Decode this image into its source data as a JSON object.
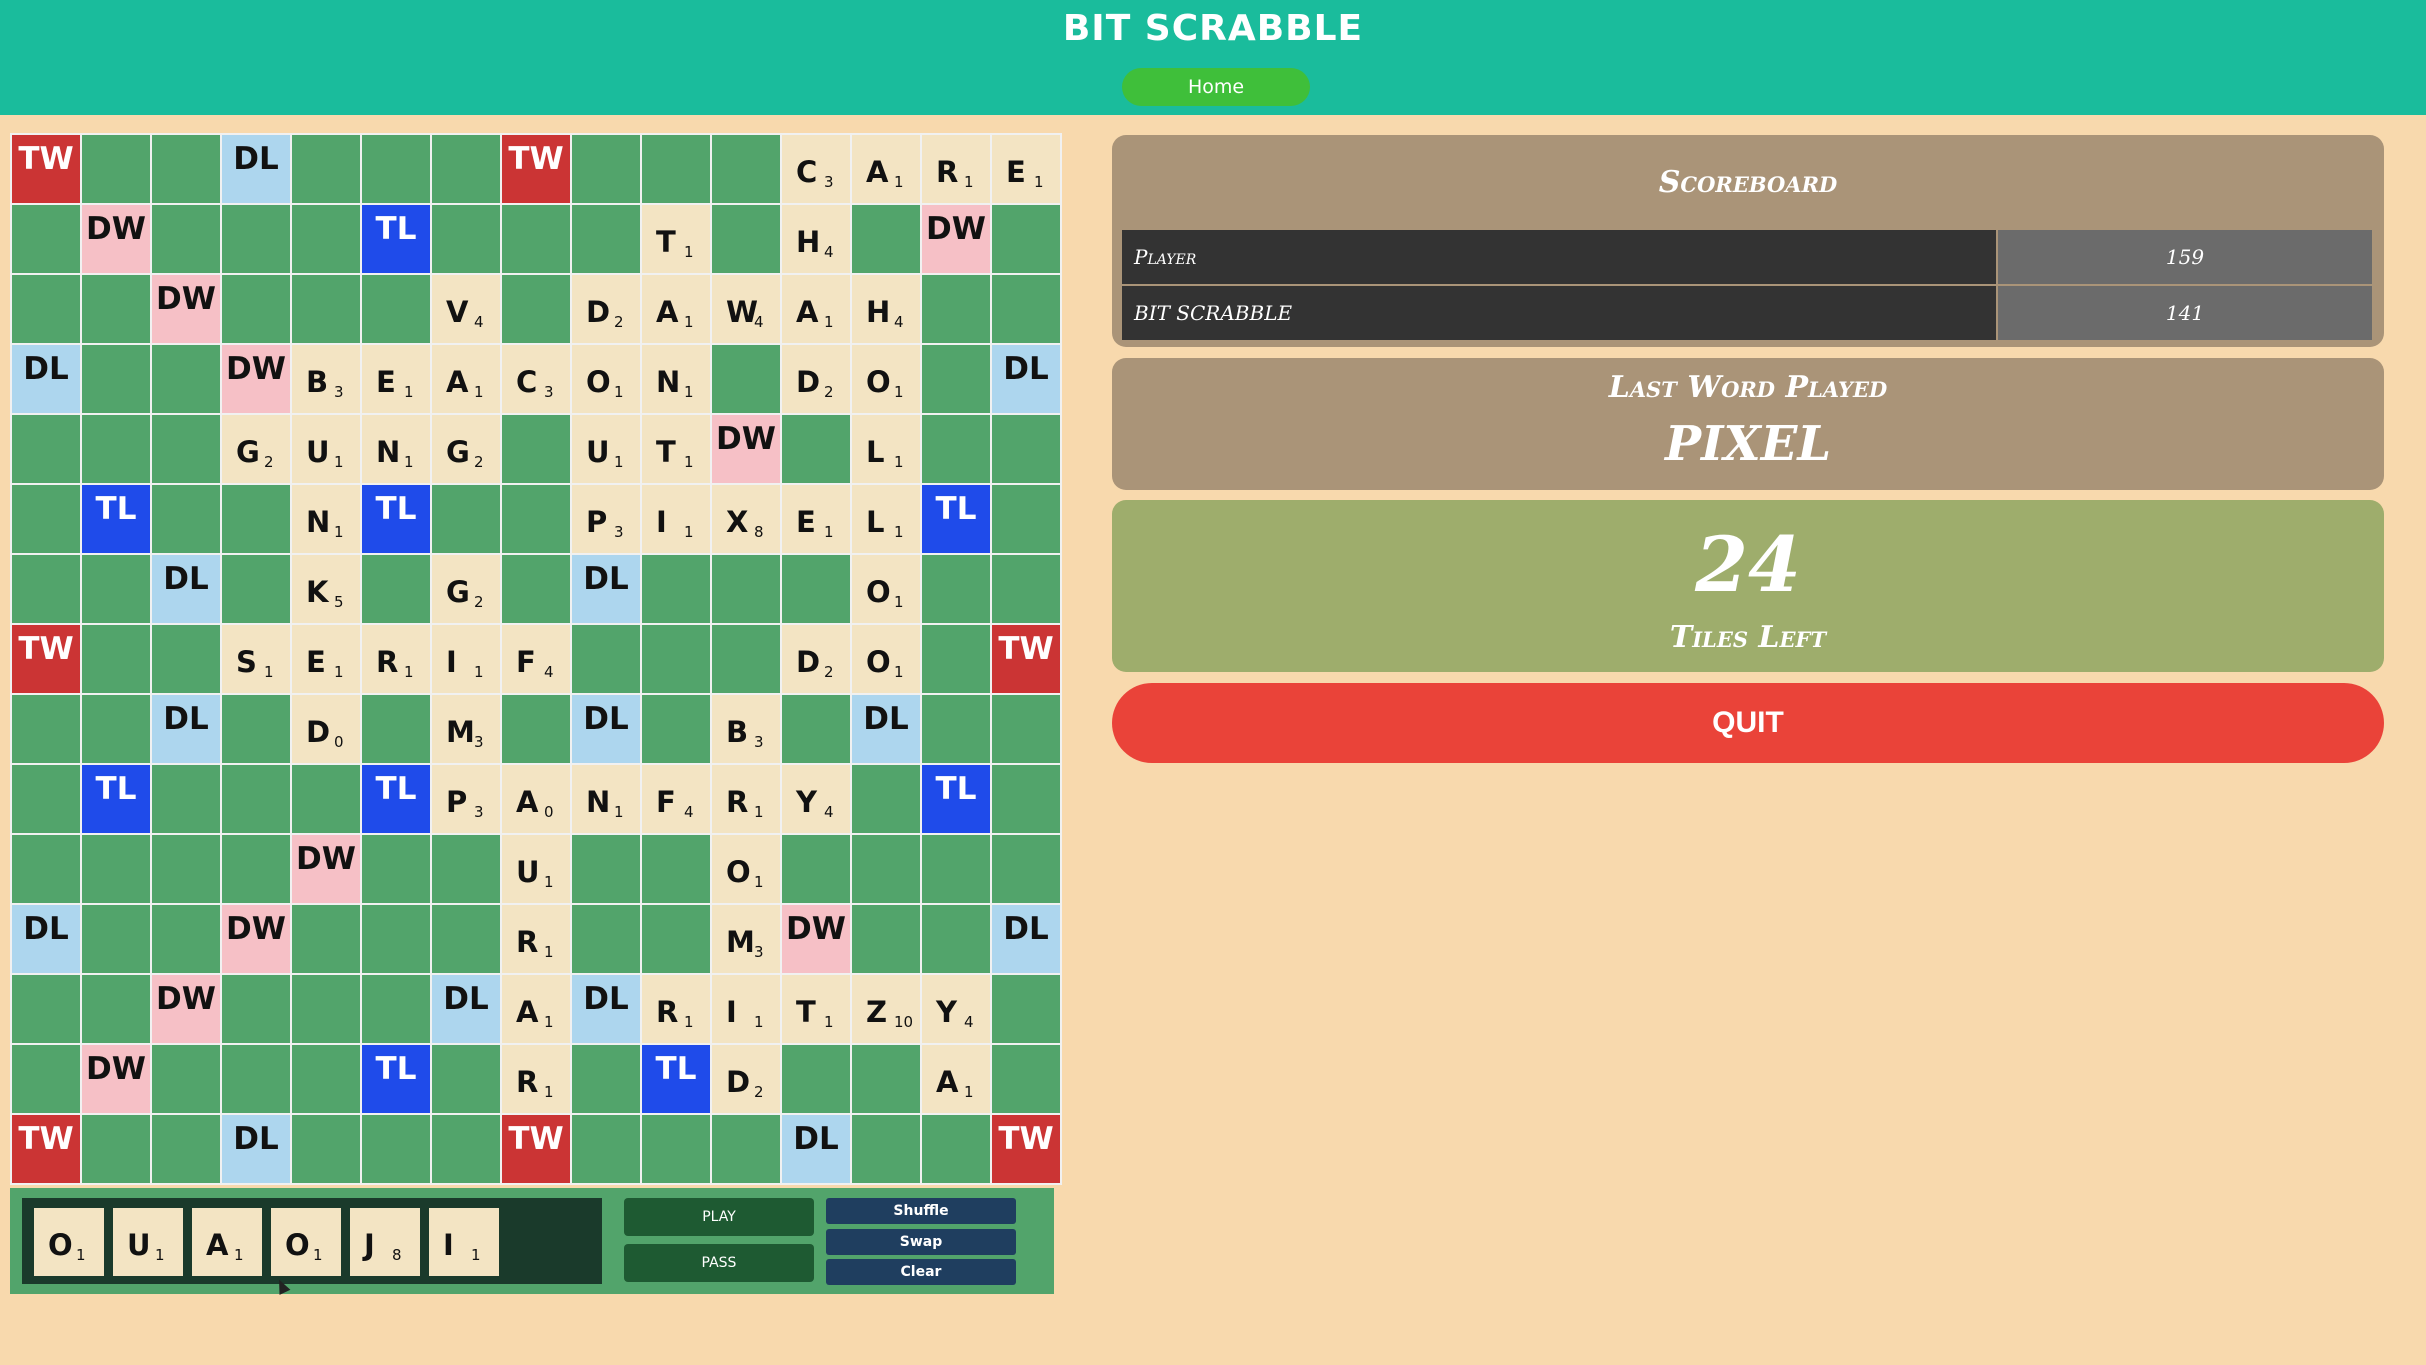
{
  "header": {
    "title": "BIT SCRABBLE",
    "home_label": "Home"
  },
  "board": {
    "rows": [
      [
        "TW",
        "",
        "",
        "DL",
        "",
        "",
        "",
        "TW",
        "",
        "",
        "",
        "C3",
        "A1",
        "R1",
        "E1"
      ],
      [
        "",
        "DW",
        "",
        "",
        "",
        "TL",
        "",
        "",
        "",
        "T1",
        "",
        "H4",
        "",
        "DW",
        ""
      ],
      [
        "",
        "",
        "DW",
        "",
        "",
        "",
        "V4",
        "",
        "D2",
        "A1",
        "W4",
        "A1",
        "H4",
        "",
        ""
      ],
      [
        "DL",
        "",
        "",
        "DW",
        "B3",
        "E1",
        "A1",
        "C3",
        "O1",
        "N1",
        "",
        "D2",
        "O1",
        "",
        "DL"
      ],
      [
        "",
        "",
        "",
        "G2",
        "U1",
        "N1",
        "G2",
        "",
        "U1",
        "T1",
        "DW",
        "",
        "L1",
        "",
        ""
      ],
      [
        "",
        "TL",
        "",
        "",
        "N1",
        "TL",
        "",
        "",
        "P3",
        "I1",
        "X8",
        "E1",
        "L1",
        "TL",
        ""
      ],
      [
        "",
        "",
        "DL",
        "",
        "K5",
        "",
        "G2",
        "",
        "DL",
        "",
        "",
        "",
        "O1",
        "",
        ""
      ],
      [
        "TW",
        "",
        "",
        "S1",
        "E1",
        "R1",
        "I1",
        "F4",
        "",
        "",
        "",
        "D2",
        "O1",
        "",
        "TW"
      ],
      [
        "",
        "",
        "DL",
        "",
        "D0",
        "",
        "M3",
        "",
        "DL",
        "",
        "B3",
        "",
        "DL",
        "",
        ""
      ],
      [
        "",
        "TL",
        "",
        "",
        "",
        "TL",
        "P3",
        "A0",
        "N1",
        "F4",
        "R1",
        "Y4",
        "",
        "TL",
        ""
      ],
      [
        "",
        "",
        "",
        "",
        "DW",
        "",
        "",
        "U1",
        "",
        "",
        "O1",
        "",
        "",
        "",
        ""
      ],
      [
        "DL",
        "",
        "",
        "DW",
        "",
        "",
        "",
        "R1",
        "",
        "",
        "M3",
        "DW",
        "",
        "",
        "DL"
      ],
      [
        "",
        "",
        "DW",
        "",
        "",
        "",
        "DL",
        "A1",
        "DL",
        "R1",
        "I1",
        "T1",
        "Z10",
        "Y4",
        ""
      ],
      [
        "",
        "DW",
        "",
        "",
        "",
        "TL",
        "",
        "R1",
        "",
        "TL",
        "D2",
        "",
        "",
        "A1",
        ""
      ],
      [
        "TW",
        "",
        "",
        "DL",
        "",
        "",
        "",
        "TW",
        "",
        "",
        "",
        "DL",
        "",
        "",
        "TW"
      ]
    ]
  },
  "rack": {
    "tiles": [
      {
        "letter": "O",
        "value": "1"
      },
      {
        "letter": "U",
        "value": "1"
      },
      {
        "letter": "A",
        "value": "1"
      },
      {
        "letter": "O",
        "value": "1"
      },
      {
        "letter": "J",
        "value": "8"
      },
      {
        "letter": "I",
        "value": "1"
      }
    ],
    "play_label": "PLAY",
    "pass_label": "PASS",
    "shuffle_label": "Shuffle",
    "swap_label": "Swap",
    "clear_label": "Clear"
  },
  "scoreboard": {
    "title": "Scoreboard",
    "rows": [
      {
        "name": "Player",
        "score": "159"
      },
      {
        "name": "BIT SCRABBLE",
        "score": "141"
      }
    ]
  },
  "last_word": {
    "title": "Last Word Played",
    "word": "PIXEL"
  },
  "tiles_left": {
    "count": "24",
    "label": "Tiles Left"
  },
  "quit_label": "QUIT"
}
